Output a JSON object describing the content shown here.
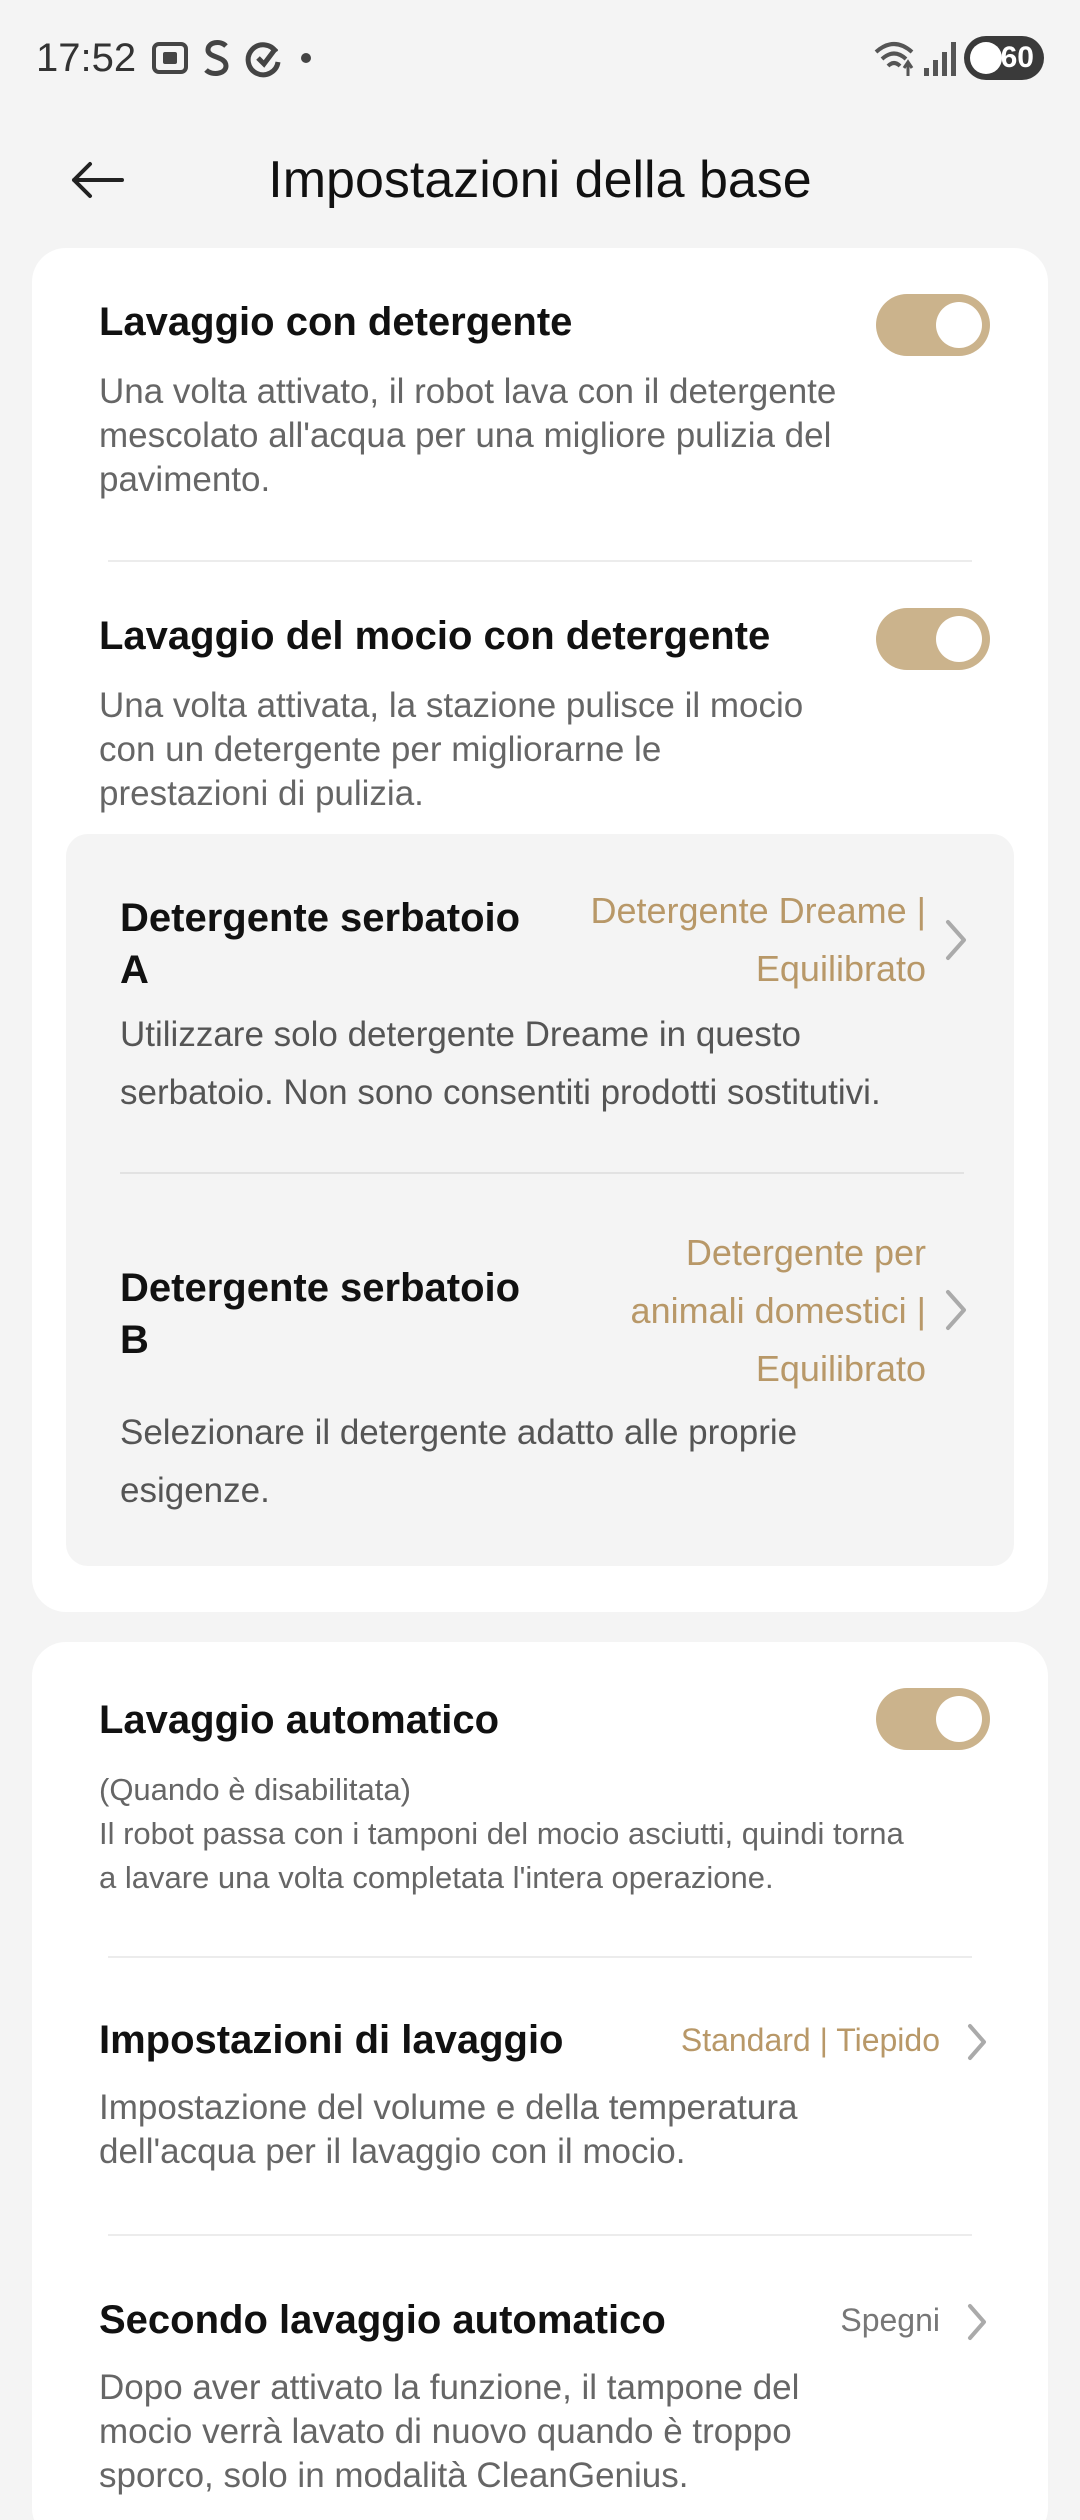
{
  "status_bar": {
    "time": "17:52",
    "battery": "60",
    "icons": [
      "screenshot-icon",
      "s-app-icon",
      "sync-icon",
      "dot-icon",
      "wifi-icon",
      "signal-icon",
      "battery-icon"
    ]
  },
  "header": {
    "title": "Impostazioni della base",
    "back_icon": "arrow-left-icon"
  },
  "card1": {
    "detergent_wash": {
      "title": "Lavaggio con detergente",
      "description": "Una volta attivato, il robot lava con il detergente mescolato all'acqua per una migliore pulizia del pavimento.",
      "enabled": true
    },
    "mop_detergent_wash": {
      "title": "Lavaggio del mocio con detergente",
      "description": "Una volta attivata, la stazione pulisce il mocio con un detergente per migliorarne le prestazioni di pulizia.",
      "enabled": true
    },
    "tank_a": {
      "title": "Detergente serbatoio A",
      "value": "Detergente Dreame | Equilibrato",
      "description": "Utilizzare solo detergente Dreame in questo serbatoio. Non sono consentiti prodotti sostitutivi."
    },
    "tank_b": {
      "title": "Detergente serbatoio B",
      "value": "Detergente per animali domestici | Equilibrato",
      "description": "Selezionare il detergente adatto alle proprie esigenze."
    }
  },
  "card2": {
    "auto_wash": {
      "title": "Lavaggio automatico",
      "note": "(Quando è disabilitata)",
      "description": "Il robot passa con i tamponi del mocio asciutti, quindi torna a lavare una volta completata l'intera operazione.",
      "enabled": true
    },
    "wash_settings": {
      "title": "Impostazioni di lavaggio",
      "value": "Standard | Tiepido",
      "description": "Impostazione del volume e della temperatura dell'acqua per il lavaggio con il mocio."
    },
    "second_auto_wash": {
      "title": "Secondo lavaggio automatico",
      "value": "Spegni",
      "description": "Dopo aver attivato la funzione, il tampone del mocio verrà lavato di nuovo quando è troppo sporco, solo in modalità CleanGenius."
    }
  },
  "colors": {
    "accent": "#cbb38c",
    "value_text": "#b89868",
    "background": "#f4f4f4",
    "card": "#ffffff"
  }
}
